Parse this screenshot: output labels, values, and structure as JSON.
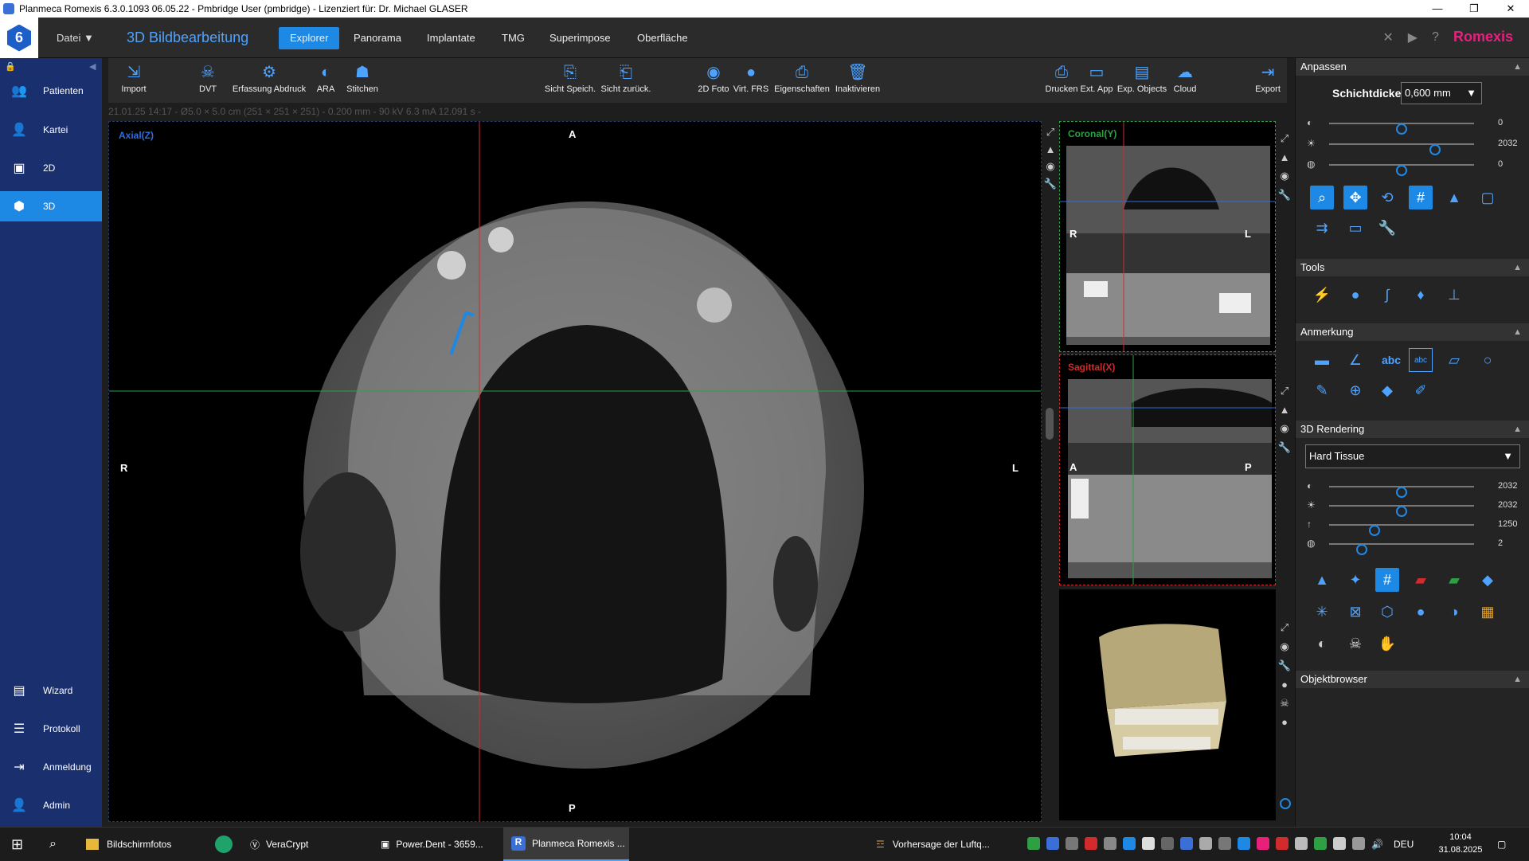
{
  "titlebar": {
    "title": "Planmeca Romexis 6.3.0.1093 06.05.22 - Pmbridge User (pmbridge) - Lizenziert für: Dr. Michael GLASER"
  },
  "appbar": {
    "datei": "Datei",
    "title": "3D Bildbearbeitung",
    "tabs": [
      "Explorer",
      "Panorama",
      "Implantate",
      "TMG",
      "Superimpose",
      "Oberfläche"
    ],
    "brand": "Romexis"
  },
  "sidebar": {
    "items": [
      {
        "label": "Patienten"
      },
      {
        "label": "Kartei"
      },
      {
        "label": "2D"
      },
      {
        "label": "3D"
      },
      {
        "label": "Wizard"
      },
      {
        "label": "Protokoll"
      },
      {
        "label": "Anmeldung"
      },
      {
        "label": "Admin"
      }
    ]
  },
  "toolbar": {
    "buttons": [
      "Import",
      "DVT",
      "Erfassung Abdruck",
      "ARA",
      "Stitchen",
      "Sicht Speich.",
      "Sicht zurück.",
      "2D Foto",
      "Virt. FRS",
      "Eigenschaften",
      "Inaktivieren",
      "Drucken",
      "Ext. App",
      "Exp. Objects",
      "Cloud",
      "Export"
    ]
  },
  "info": "21.01.25 14:17 - Ø5.0 × 5.0 cm (251 × 251 × 251) - 0.200 mm - 90 kV 6.3 mA 12.091 s -",
  "views": {
    "axial": {
      "label": "Axial(Z)",
      "top": "A",
      "bottom": "P",
      "left": "R",
      "right": "L"
    },
    "coronal": {
      "label": "Coronal(Y)",
      "left": "R",
      "right": "L"
    },
    "sagittal": {
      "label": "Sagittal(X)",
      "left": "A",
      "right": "P"
    }
  },
  "panel": {
    "anpassen": {
      "title": "Anpassen",
      "schicht_label": "Schichtdicke",
      "schicht_value": "0,600 mm",
      "sliders": [
        {
          "value": "0",
          "level": 0.5
        },
        {
          "value": "2032",
          "level": 0.75
        },
        {
          "value": "0",
          "level": 0.5
        }
      ]
    },
    "tools": {
      "title": "Tools"
    },
    "anmerkung": {
      "title": "Anmerkung",
      "abc": "abc",
      "abc_box": "abc"
    },
    "rendering": {
      "title": "3D Rendering",
      "preset": "Hard Tissue",
      "sliders": [
        {
          "value": "2032",
          "level": 0.5
        },
        {
          "value": "2032",
          "level": 0.5
        },
        {
          "value": "1250",
          "level": 0.3
        },
        {
          "value": "2",
          "level": 0.2
        }
      ]
    },
    "objektbrowser": {
      "title": "Objektbrowser"
    }
  },
  "taskbar": {
    "items": [
      "Bildschirmfotos",
      "VeraCrypt",
      "Power.Dent - 3659...",
      "Planmeca Romexis ..."
    ],
    "weather": "Vorhersage der Luftq...",
    "lang": "DEU",
    "time": "10:04",
    "date": "31.08.2025"
  }
}
